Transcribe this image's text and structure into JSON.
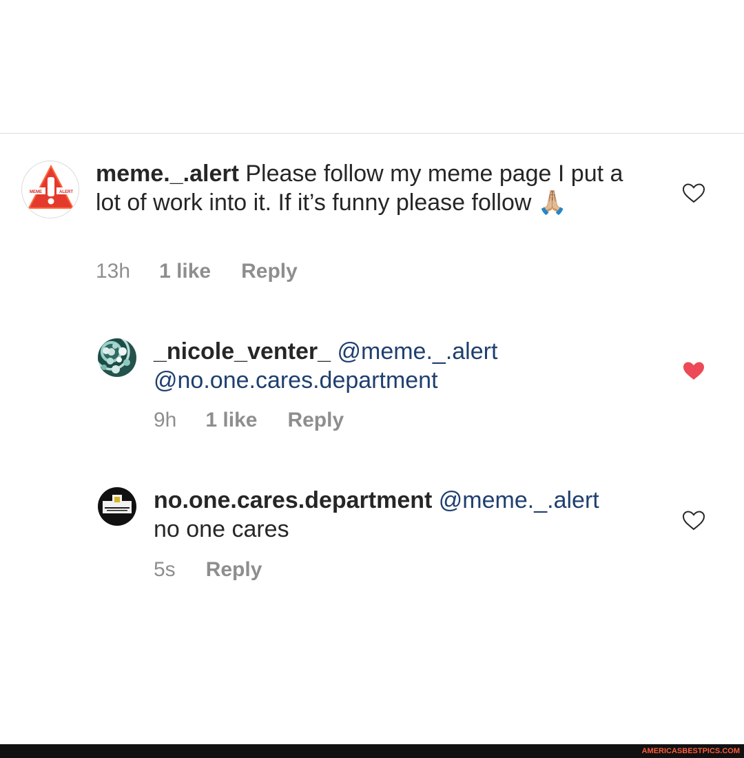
{
  "comments": [
    {
      "username": "meme._.alert",
      "text": "Please follow my meme page I put a lot of work into it. If it’s funny please follow",
      "emoji": "🙏🏼",
      "time": "13h",
      "likes": "1 like",
      "reply_label": "Reply",
      "liked": false,
      "avatar_label_left": "MEME",
      "avatar_label_right": "ALERT"
    },
    {
      "username": "_nicole_venter_",
      "mentions": [
        "@meme._.alert",
        "@no.one.cares.department"
      ],
      "time": "9h",
      "likes": "1 like",
      "reply_label": "Reply",
      "liked": true
    },
    {
      "username": "no.one.cares.department",
      "mention": "@meme._.alert",
      "text": "no one cares",
      "time": "5s",
      "reply_label": "Reply",
      "liked": false
    }
  ],
  "colors": {
    "liked_heart": "#ed4956",
    "mention_text": "#1e3f6f",
    "meta_text": "#8e8e8e",
    "watermark_text": "#ff5c3b"
  },
  "icons": {
    "like_outline": "heart-outline-icon",
    "like_filled": "heart-filled-icon"
  },
  "watermark": {
    "text": "AMERICASBESTPICS.COM"
  }
}
